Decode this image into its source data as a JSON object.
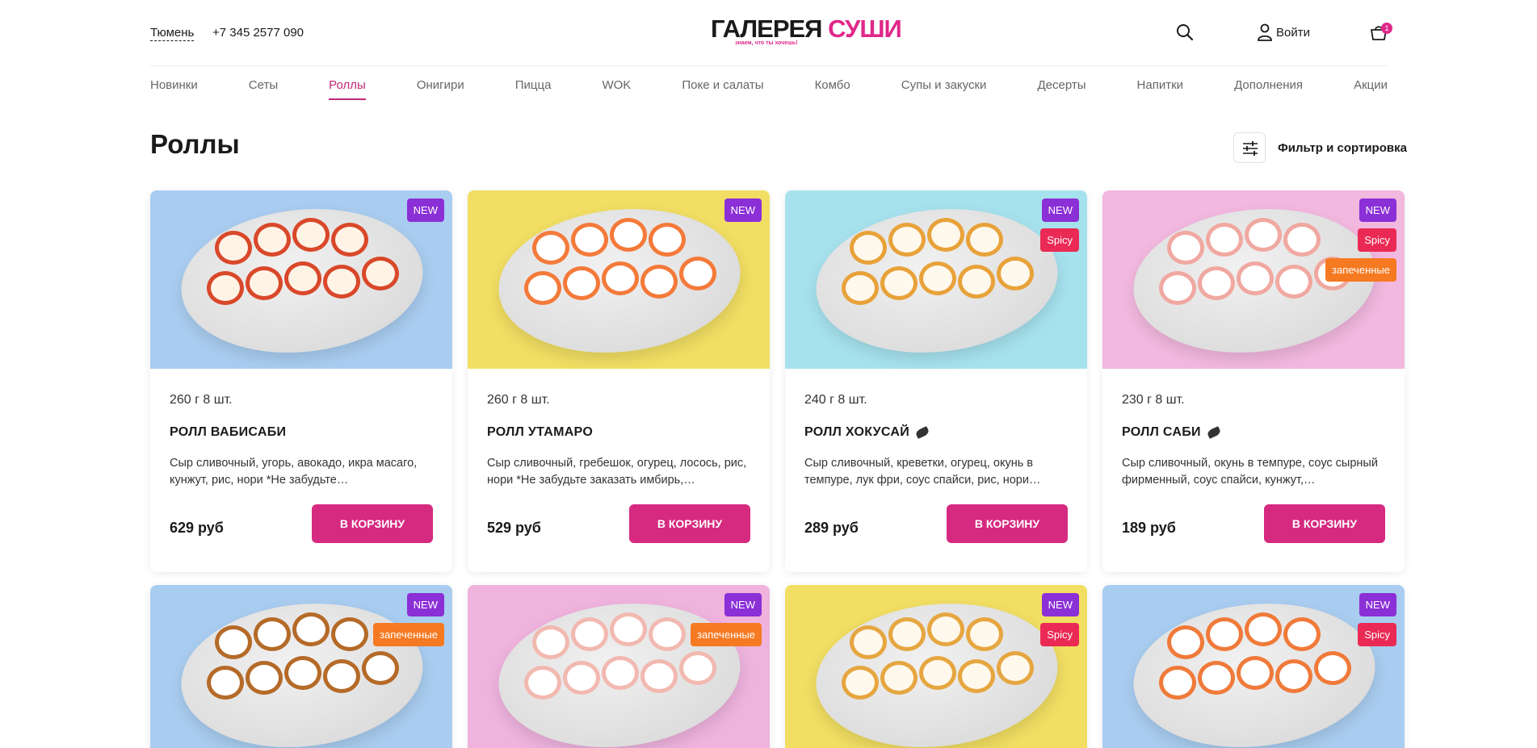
{
  "header": {
    "city": "Тюмень",
    "phone": "+7 345 2577 090",
    "logo_part1": "ГАЛЕРЕЯ ",
    "logo_part2": "СУШИ",
    "logo_tagline": "знаем, что ты хочешь!",
    "login_label": "Войти",
    "cart_count": "1"
  },
  "nav": [
    {
      "label": "Новинки",
      "active": false
    },
    {
      "label": "Сеты",
      "active": false
    },
    {
      "label": "Роллы",
      "active": true
    },
    {
      "label": "Онигири",
      "active": false
    },
    {
      "label": "Пицца",
      "active": false
    },
    {
      "label": "WOK",
      "active": false
    },
    {
      "label": "Поке и салаты",
      "active": false
    },
    {
      "label": "Комбо",
      "active": false
    },
    {
      "label": "Супы и закуски",
      "active": false
    },
    {
      "label": "Десерты",
      "active": false
    },
    {
      "label": "Напитки",
      "active": false
    },
    {
      "label": "Дополнения",
      "active": false
    },
    {
      "label": "Акции",
      "active": false
    }
  ],
  "page": {
    "title": "Роллы",
    "filter_label": "Фильтр и сортировка"
  },
  "tags": {
    "new": "NEW",
    "spicy": "Spicy",
    "baked": "запеченные"
  },
  "products": [
    {
      "weight": "260 г 8 шт.",
      "name": "РОЛЛ ВАБИСАБИ",
      "spicy_icon": false,
      "desc": "Сыр сливочный, угорь, авокадо, икра масаго, кунжут, рис, нори *Не забудьте…",
      "price": "629 руб",
      "button": "В КОРЗИНУ",
      "bg": "#a9cdf0",
      "tags": [
        "new"
      ]
    },
    {
      "weight": "260 г 8 шт.",
      "name": "РОЛЛ УТАМАРО",
      "spicy_icon": false,
      "desc": "Сыр сливочный, гребешок, огурец, лосось, рис, нори *Не забудьте заказать имбирь,…",
      "price": "529 руб",
      "button": "В КОРЗИНУ",
      "bg": "#f1de63",
      "tags": [
        "new"
      ]
    },
    {
      "weight": "240 г 8 шт.",
      "name": "РОЛЛ ХОКУСАЙ",
      "spicy_icon": true,
      "desc": "Сыр сливочный, креветки, огурец, окунь в темпуре, лук фри, соус спайси, рис, нори…",
      "price": "289 руб",
      "button": "В КОРЗИНУ",
      "bg": "#a6e2ee",
      "tags": [
        "new",
        "spicy"
      ]
    },
    {
      "weight": "230 г 8 шт.",
      "name": "РОЛЛ САБИ",
      "spicy_icon": true,
      "desc": "Сыр сливочный, окунь в темпуре, соус сырный фирменный, соус спайси, кунжут,…",
      "price": "189 руб",
      "button": "В КОРЗИНУ",
      "bg": "#f2b8df",
      "tags": [
        "new",
        "spicy",
        "baked"
      ]
    },
    {
      "bg": "#a9cdf0",
      "tags": [
        "new",
        "baked"
      ]
    },
    {
      "bg": "#efb3de",
      "tags": [
        "new",
        "baked"
      ]
    },
    {
      "bg": "#f1de63",
      "tags": [
        "new",
        "spicy"
      ]
    },
    {
      "bg": "#a9cdf0",
      "tags": [
        "new",
        "spicy"
      ]
    }
  ],
  "colors": {
    "accent": "#d62a80",
    "nav_active": "#c0287a",
    "tag_new": "#8b2fd6",
    "tag_spicy": "#ea2a54",
    "tag_baked": "#f57a22"
  }
}
